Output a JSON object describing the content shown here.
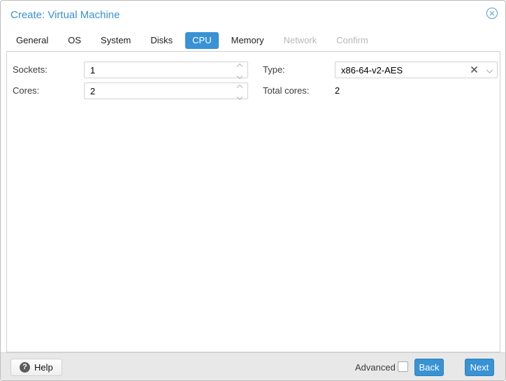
{
  "window": {
    "title": "Create: Virtual Machine"
  },
  "tabs": [
    {
      "label": "General",
      "state": "normal"
    },
    {
      "label": "OS",
      "state": "normal"
    },
    {
      "label": "System",
      "state": "normal"
    },
    {
      "label": "Disks",
      "state": "normal"
    },
    {
      "label": "CPU",
      "state": "active"
    },
    {
      "label": "Memory",
      "state": "normal"
    },
    {
      "label": "Network",
      "state": "disabled"
    },
    {
      "label": "Confirm",
      "state": "disabled"
    }
  ],
  "form": {
    "sockets": {
      "label": "Sockets:",
      "value": "1",
      "control": "spinner"
    },
    "cores": {
      "label": "Cores:",
      "value": "2",
      "control": "spinner"
    },
    "type": {
      "label": "Type:",
      "value": "x86-64-v2-AES",
      "control": "combo-clearable"
    },
    "total_cores": {
      "label": "Total cores:",
      "value": "2",
      "control": "display"
    }
  },
  "footer": {
    "help_label": "Help",
    "help_icon_glyph": "?",
    "advanced_label": "Advanced",
    "advanced_checked": false,
    "back_label": "Back",
    "next_label": "Next"
  },
  "icons": {
    "close": "circle-x-icon",
    "spinner_up": "chevron-up-icon",
    "spinner_down": "chevron-down-icon",
    "combo_clear": "x-clear-icon",
    "combo_open": "chevron-down-icon"
  },
  "colors": {
    "accent": "#3892d4",
    "disabled_tab_text": "#b8b8b8",
    "footer_background": "#e8e8e8",
    "field_border": "#d2d2d2",
    "panel_border": "#d0d0d0",
    "close_icon": "#7aaedd"
  }
}
